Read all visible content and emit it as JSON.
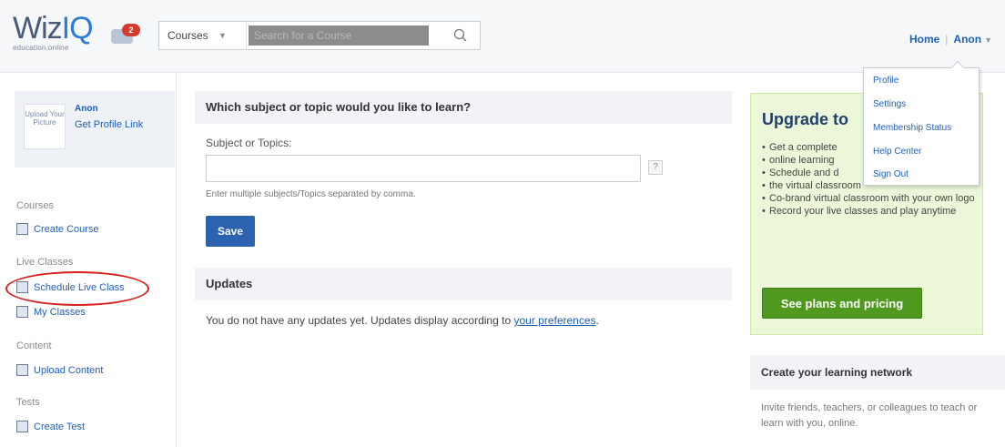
{
  "header": {
    "logo_main": "Wiz",
    "logo_accent": "IQ",
    "logo_tagline": "education.online",
    "message_count": "2",
    "search": {
      "category": "Courses",
      "placeholder": "Search for a Course"
    },
    "nav": {
      "home": "Home",
      "user": "Anon"
    }
  },
  "user_menu": {
    "items": [
      "Profile",
      "Settings",
      "Membership Status",
      "Help Center",
      "Sign Out"
    ]
  },
  "sidebar": {
    "profile": {
      "avatar_text": "Upload Your Picture",
      "name": "Anon",
      "profile_link": "Get Profile Link"
    },
    "sections": [
      {
        "label": "Courses",
        "links": [
          "Create Course"
        ]
      },
      {
        "label": "Live Classes",
        "links": [
          "Schedule Live Class",
          "My Classes"
        ]
      },
      {
        "label": "Content",
        "links": [
          "Upload Content"
        ]
      },
      {
        "label": "Tests",
        "links": [
          "Create Test"
        ]
      }
    ]
  },
  "main": {
    "learn": {
      "title": "Which subject or topic would you like to learn?",
      "field_label": "Subject or Topics:",
      "help": "?",
      "hint": "Enter multiple subjects/Topics separated by comma.",
      "save": "Save"
    },
    "updates": {
      "title": "Updates",
      "text": "You do not have any updates yet. Updates display according to ",
      "link": "your preferences",
      "tail": "."
    }
  },
  "upgrade": {
    "title": "Upgrade to",
    "bullets": [
      "Get a complete",
      "online learning",
      "Schedule and d",
      "the virtual classroom",
      "Co-brand virtual classroom with your own logo",
      "Record your live classes and play anytime"
    ],
    "cta": "See plans and pricing"
  },
  "network": {
    "title": "Create your learning network",
    "text": "Invite friends, teachers, or colleagues to teach or learn with you, online."
  },
  "colors": {
    "brand_blue": "#1f5fb6",
    "save_blue": "#2d62b0",
    "cta_green": "#4f9a1e",
    "upgrade_bg": "#ecf7d9",
    "highlight_red": "#d81d1d"
  }
}
